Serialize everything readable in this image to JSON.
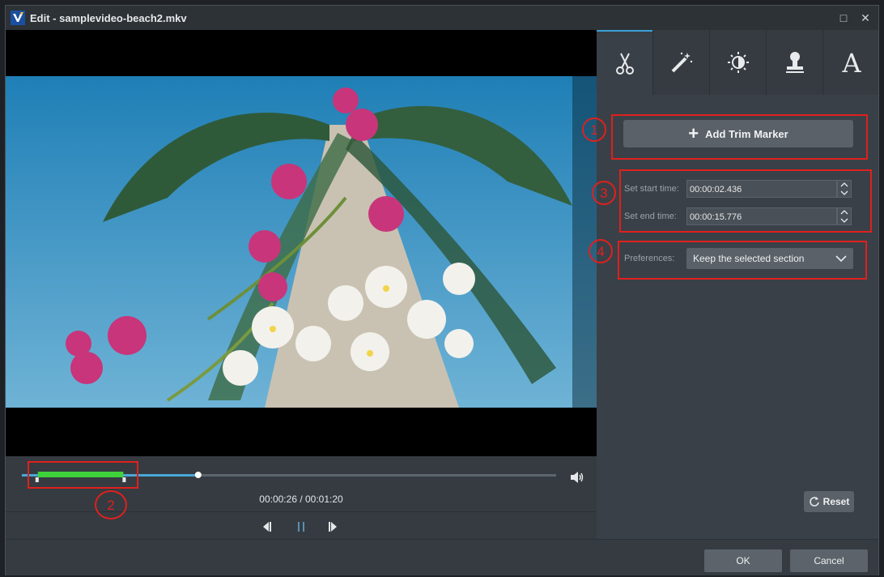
{
  "window": {
    "title": "Edit - samplevideo-beach2.mkv"
  },
  "tabs": [
    {
      "name": "trim",
      "icon": "scissors-icon"
    },
    {
      "name": "effects",
      "icon": "magic-wand-icon"
    },
    {
      "name": "adjust",
      "icon": "brightness-icon"
    },
    {
      "name": "watermark",
      "icon": "stamp-icon"
    },
    {
      "name": "text",
      "icon": "text-icon"
    }
  ],
  "trim": {
    "add_marker_label": "Add Trim Marker",
    "start_label": "Set start time:",
    "start_value": "00:00:02.436",
    "end_label": "Set end time:",
    "end_value": "00:00:15.776",
    "preferences_label": "Preferences:",
    "preferences_value": "Keep the selected section",
    "reset_label": "Reset"
  },
  "player": {
    "time_display": "00:00:26 / 00:01:20",
    "progress": 0.33,
    "trim_start_fraction": 0.03,
    "trim_end_fraction": 0.19
  },
  "annotations": [
    "1",
    "2",
    "3",
    "4"
  ],
  "footer": {
    "ok_label": "OK",
    "cancel_label": "Cancel"
  },
  "colors": {
    "accent": "#3aa0d8",
    "trim_segment": "#3fd23a",
    "annotation": "#e0201e"
  }
}
